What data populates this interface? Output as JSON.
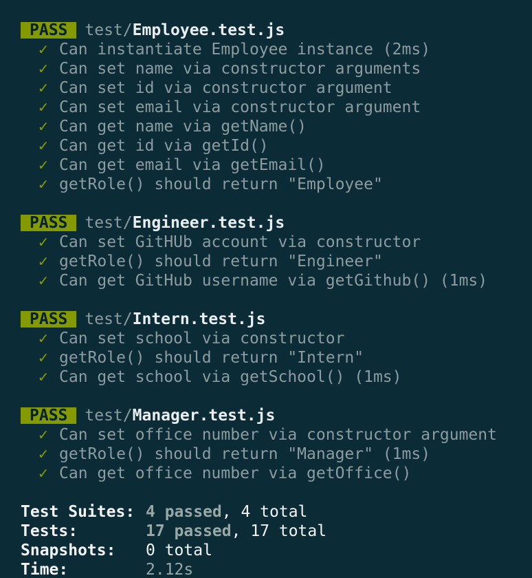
{
  "suites": [
    {
      "status": "PASS",
      "dir": "test/",
      "file": "Employee.test.js",
      "tests": [
        "Can instantiate Employee instance (2ms)",
        "Can set name via constructor arguments",
        "Can set id via constructor argument",
        "Can set email via constructor argument",
        "Can get name via getName()",
        "Can get id via getId()",
        "Can get email via getEmail()",
        "getRole() should return \"Employee\""
      ]
    },
    {
      "status": "PASS",
      "dir": "test/",
      "file": "Engineer.test.js",
      "tests": [
        "Can set GitHUb account via constructor",
        "getRole() should return \"Engineer\"",
        "Can get GitHub username via getGithub() (1ms)"
      ]
    },
    {
      "status": "PASS",
      "dir": "test/",
      "file": "Intern.test.js",
      "tests": [
        "Can set school via constructor",
        "getRole() should return \"Intern\"",
        "Can get school via getSchool() (1ms)"
      ]
    },
    {
      "status": "PASS",
      "dir": "test/",
      "file": "Manager.test.js",
      "tests": [
        "Can set office number via constructor argument",
        "getRole() should return \"Manager\" (1ms)",
        "Can get office number via getOffice()"
      ]
    }
  ],
  "check_glyph": "✓",
  "summary": {
    "suites_label": "Test Suites:",
    "suites_passed": "4 passed",
    "suites_total": ", 4 total",
    "tests_label": "Tests:",
    "tests_passed": "17 passed",
    "tests_total": ", 17 total",
    "snapshots_label": "Snapshots:",
    "snapshots_value": "0 total",
    "time_label": "Time:",
    "time_value": "2.12s"
  },
  "colors": {
    "background": "#0b2b36",
    "pass_badge": "#859900",
    "check": "#859900",
    "muted_text": "#8d9ca1",
    "bright_text": "#f2f4f5"
  }
}
